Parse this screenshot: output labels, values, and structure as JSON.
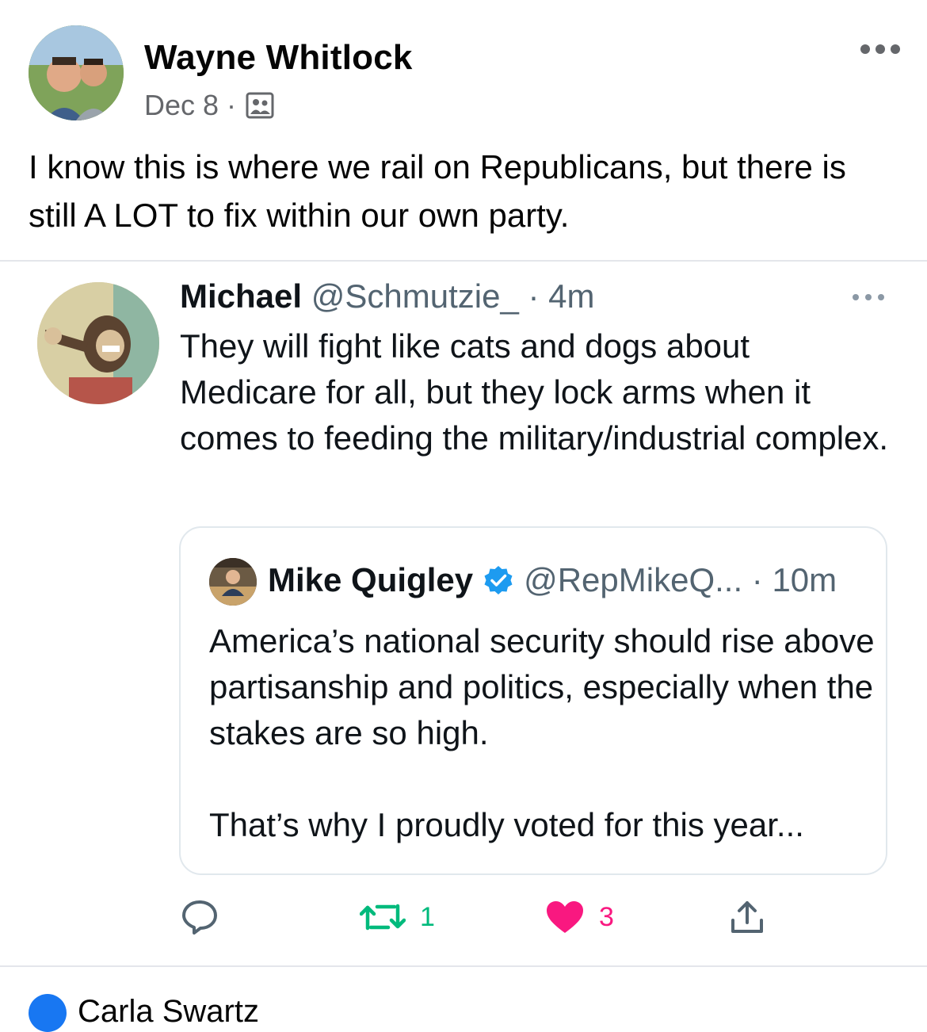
{
  "post": {
    "author": "Wayne Whitlock",
    "date": "Dec 8",
    "separator": "·",
    "audience_icon": "custom-audience-icon",
    "text": "I know this is where we rail on Republicans, but there is still A LOT to fix within our own party."
  },
  "tweet": {
    "name": "Michael",
    "handle": "@Schmutzie_",
    "time": "· 4m",
    "text": "They will fight like cats and dogs about Medicare for all, but they lock arms when it comes to feeding the military/industrial complex.",
    "quoted": {
      "name": "Mike Quigley",
      "verified": true,
      "handle_time": "@RepMikeQ... · 10m",
      "text_1": "America’s national security should rise above partisanship and politics, especially when the stakes are so high.",
      "text_2": "That’s why I proudly voted for this year..."
    },
    "actions": {
      "reply_icon": "reply-icon",
      "retweet_count": "1",
      "like_count": "3",
      "share_icon": "share-icon"
    }
  },
  "comment_preview": {
    "author": "Carla Swartz"
  },
  "colors": {
    "verified": "#1d9bf0",
    "retweet": "#00ba7c",
    "like": "#f91880",
    "secondary": "#65676b"
  }
}
